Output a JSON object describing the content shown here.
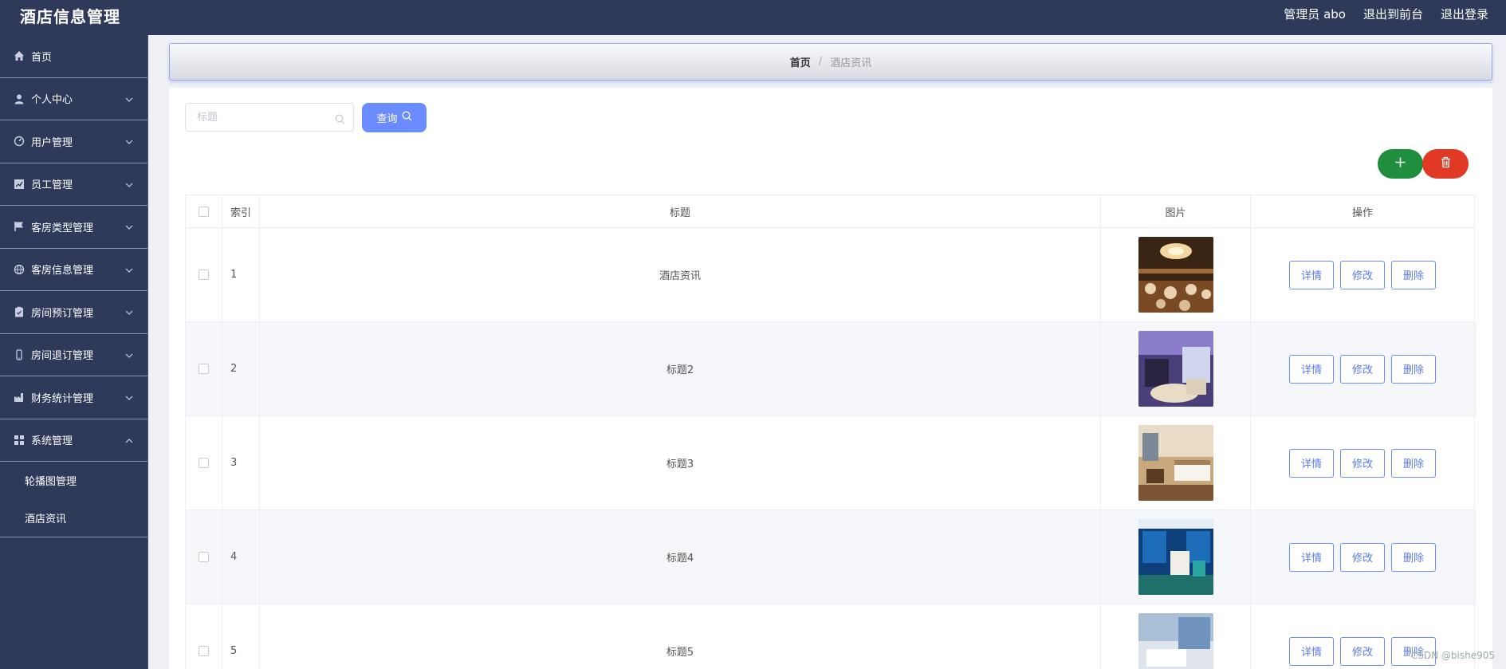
{
  "app": {
    "title": "酒店信息管理"
  },
  "topbar": {
    "user": "管理员 abo",
    "to_front": "退出到前台",
    "logout": "退出登录"
  },
  "sidebar": {
    "items": [
      {
        "label": "首页",
        "icon": "home-icon",
        "expandable": false
      },
      {
        "label": "个人中心",
        "icon": "user-icon",
        "expandable": true
      },
      {
        "label": "用户管理",
        "icon": "dashboard-icon",
        "expandable": true
      },
      {
        "label": "员工管理",
        "icon": "chart-icon",
        "expandable": true
      },
      {
        "label": "客房类型管理",
        "icon": "flag-icon",
        "expandable": true
      },
      {
        "label": "客房信息管理",
        "icon": "globe-icon",
        "expandable": true
      },
      {
        "label": "房间预订管理",
        "icon": "clipboard-icon",
        "expandable": true
      },
      {
        "label": "房间退订管理",
        "icon": "phone-icon",
        "expandable": true
      },
      {
        "label": "财务统计管理",
        "icon": "factory-icon",
        "expandable": true
      },
      {
        "label": "系统管理",
        "icon": "grid-icon",
        "expandable": true,
        "expanded": true
      }
    ],
    "subitems": [
      {
        "label": "轮播图管理"
      },
      {
        "label": "酒店资讯"
      }
    ]
  },
  "breadcrumb": {
    "home": "首页",
    "separator": "/",
    "current": "酒店资讯"
  },
  "search": {
    "placeholder": "标题",
    "value": "",
    "button": "查询"
  },
  "table": {
    "columns": [
      "索引",
      "标题",
      "图片",
      "操作"
    ],
    "actions": [
      "详情",
      "修改",
      "删除"
    ],
    "rows": [
      {
        "index": "1",
        "title": "酒店资讯",
        "image": "ballroom"
      },
      {
        "index": "2",
        "title": "标题2",
        "image": "suite-purple"
      },
      {
        "index": "3",
        "title": "标题3",
        "image": "bedroom-warm"
      },
      {
        "index": "4",
        "title": "标题4",
        "image": "room-blue"
      },
      {
        "index": "5",
        "title": "标题5",
        "image": "room-bright"
      }
    ]
  },
  "watermark": "CSDN @bishe905",
  "colors": {
    "sidebar": "#2f3a5a",
    "primary": "#6b8cff",
    "add": "#1f8f3d",
    "delete": "#e03a24"
  }
}
